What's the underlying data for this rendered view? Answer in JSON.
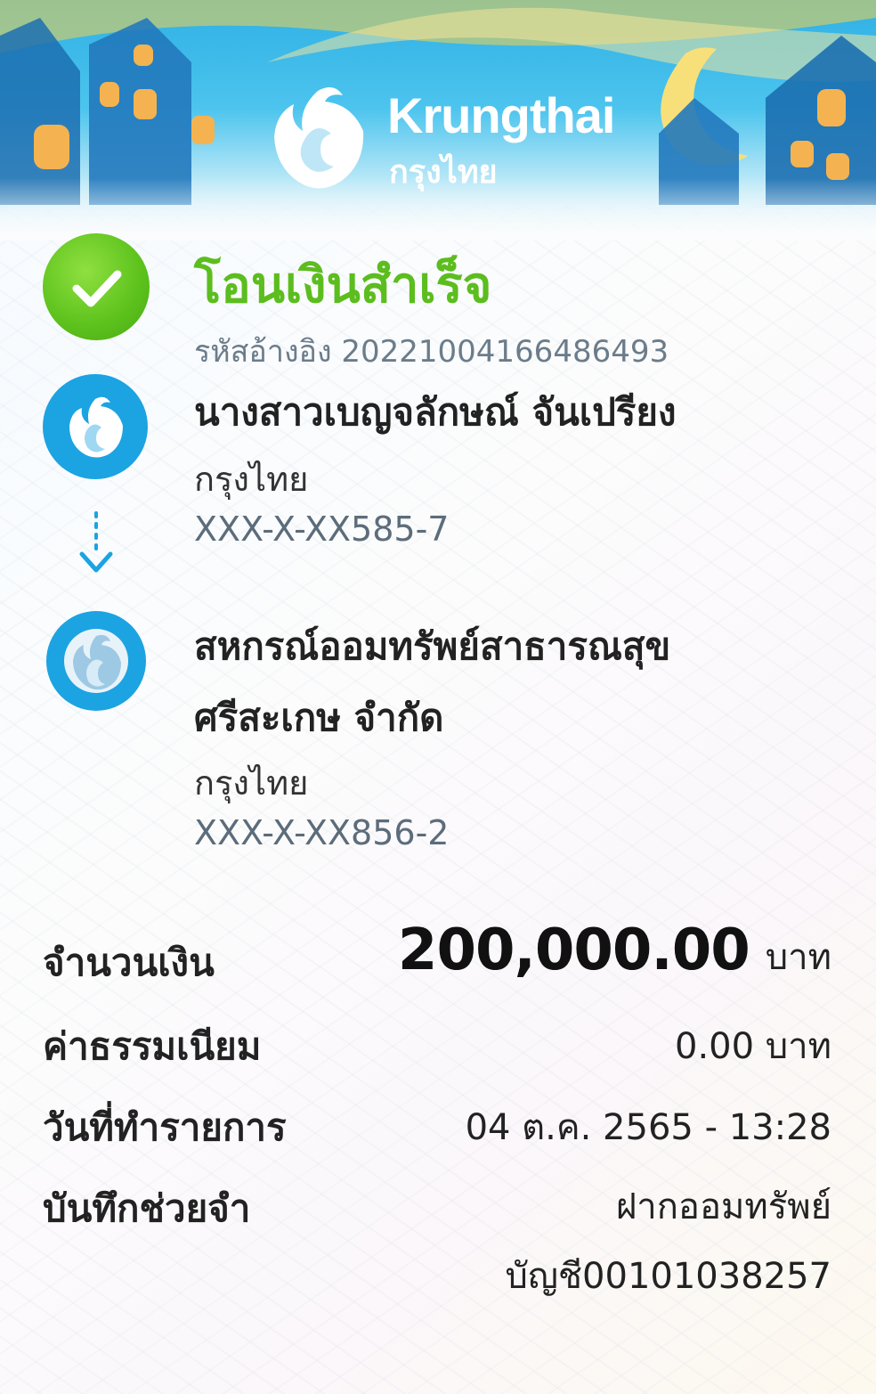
{
  "header": {
    "brand_en": "Krungthai",
    "brand_th": "กรุงไทย",
    "logo_icon": "garuda-bird-logo"
  },
  "status": {
    "title": "โอนเงินสำเร็จ",
    "reference_label": "รหัสอ้างอิง",
    "reference_number": "2022100416648649",
    "reference_text": "รหัสอ้างอิง 20221004166486493",
    "icon": "check-icon",
    "color": "#5cbd1e"
  },
  "sender": {
    "name": "นางสาวเบญจลักษณ์ จันเปรียง",
    "bank": "กรุงไทย",
    "account": "XXX-X-XX585-7"
  },
  "receiver": {
    "name_line1": "สหกรณ์ออมทรัพย์สาธารณสุข",
    "name_line2": "ศรีสะเกษ จำกัด",
    "bank": "กรุงไทย",
    "account": "XXX-X-XX856-2"
  },
  "details": {
    "amount_label": "จำนวนเงิน",
    "amount_value": "200,000.00",
    "amount_unit": "บาท",
    "fee_label": "ค่าธรรมเนียม",
    "fee_value": "0.00 บาท",
    "date_label": "วันที่ทำรายการ",
    "date_value": "04 ต.ค. 2565 - 13:28",
    "memo_label": "บันทึกช่วยจำ",
    "memo_line1": "ฝากออมทรัพย์",
    "memo_line2": "บัญชี00101038257"
  },
  "colors": {
    "brand_blue": "#1ca3e2",
    "success_green": "#5cbd1e"
  }
}
